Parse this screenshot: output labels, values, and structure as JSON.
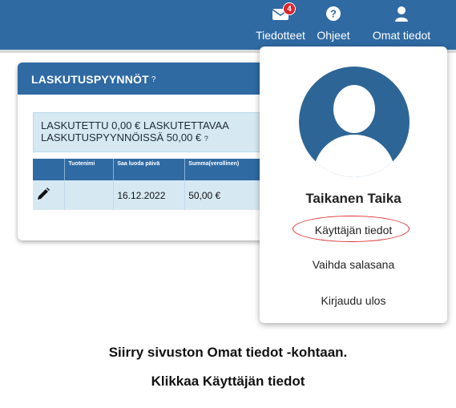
{
  "topnav": {
    "notices_label": "Tiedotteet",
    "notices_badge": "4",
    "help_label": "Ohjeet",
    "profile_label": "Omat tiedot"
  },
  "card": {
    "title": "LASKUTUSPYYNNÖT",
    "help_icon": "?",
    "info_text": "LASKUTETTU 0,00 €    LASKUTETTAVAA LASKUTUSPYYNNÖISSÄ 50,00 €",
    "info_help_icon": "?",
    "table": {
      "headers": [
        "",
        "Tuotenimi",
        "Saa luoda päivä",
        "Summa(verollinen)"
      ],
      "rows": [
        {
          "product": "",
          "date": "16.12.2022",
          "amount": "50,00 €"
        }
      ]
    }
  },
  "dropdown": {
    "user_name": "Taikanen Taika",
    "items": [
      "Käyttäjän tiedot",
      "Vaihda salasana",
      "Kirjaudu ulos"
    ]
  },
  "instructions": {
    "line1": "Siirry sivuston Omat tiedot -kohtaan.",
    "line2": "Klikkaa Käyttäjän tiedot"
  },
  "colors": {
    "primary": "#2f6aa3",
    "info_bg": "#d6e9f3",
    "badge": "#d9262e",
    "highlight": "#dd3333"
  },
  "icons": {
    "notices": "envelope-icon",
    "help": "question-circle-icon",
    "profile": "user-icon",
    "edit": "pencil-icon"
  }
}
